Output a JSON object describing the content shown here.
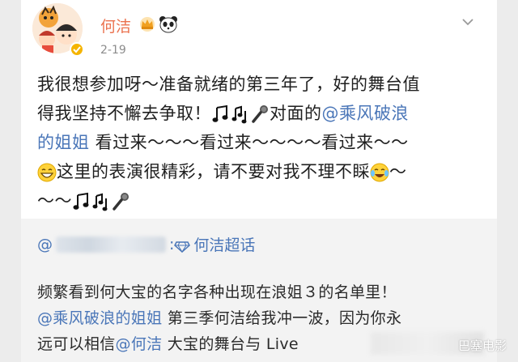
{
  "post": {
    "username": "何洁",
    "date": "2-19",
    "line1": "我很想参加呀～准备就绪的第三年了，好的舞台值",
    "line2a": "得我坚持不懈去争取！",
    "line2b": "对面的",
    "line2_mention": "@乘风破浪",
    "line3_mention": "的姐姐",
    "line3b": " 看过来～～～看过来～～～～看过来～～",
    "line4": "这里的表演很精彩，请不要对我不理不睬",
    "line4b": "～",
    "line5": "～～"
  },
  "repost": {
    "at": "@",
    "topic": "何洁超话",
    "line1": "频繁看到何大宝的名字各种出现在浪姐３的名单里！",
    "line2_mention": "@乘风破浪的姐姐",
    "line2b": " 第三季何洁给我冲一波，因为你永",
    "line3a": "远可以相信",
    "line3_mention": "@何洁",
    "line3b": " 大宝的舞台与 Live"
  },
  "watermark": "巴塞电影",
  "colors": {
    "username": "#eb7350",
    "mention": "#4a76b8",
    "text": "#1f1f1f"
  },
  "icons": [
    "verified-badge-icon",
    "crown-badge-icon",
    "panda-badge-icon",
    "chevron-down-icon",
    "music-note-icon",
    "music-notes-icon",
    "microphone-icon",
    "grin-emoji-icon",
    "laugh-cry-emoji-icon",
    "topic-diamond-icon"
  ]
}
